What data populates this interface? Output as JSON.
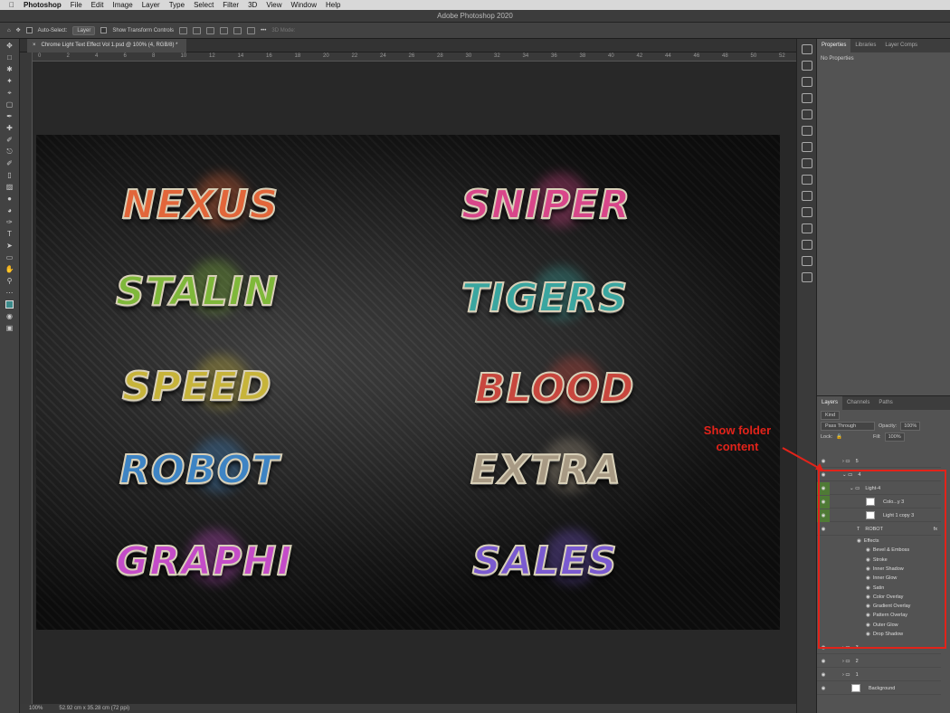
{
  "menubar": {
    "apple": "",
    "app": "Photoshop",
    "items": [
      "File",
      "Edit",
      "Image",
      "Layer",
      "Type",
      "Select",
      "Filter",
      "3D",
      "View",
      "Window",
      "Help"
    ]
  },
  "window_title": "Adobe Photoshop 2020",
  "options": {
    "auto_select": "Auto-Select:",
    "layer_value": "Layer",
    "show_transform": "Show Transform Controls",
    "mode_3d": "3D Mode:"
  },
  "doc_tab": "Chrome Light Text Effect Vol 1.psd @ 100% (4, RGB/8) *",
  "ruler_ticks": [
    "0",
    "2",
    "4",
    "6",
    "8",
    "10",
    "12",
    "14",
    "16",
    "18",
    "20",
    "22",
    "24",
    "26",
    "28",
    "30",
    "32",
    "34",
    "36",
    "38",
    "40",
    "42",
    "44",
    "46",
    "48",
    "50",
    "52"
  ],
  "artwork": {
    "words": [
      {
        "text": "NEXUS",
        "color": "#e2663a"
      },
      {
        "text": "SNIPER",
        "color": "#d8468a"
      },
      {
        "text": "STALIN",
        "color": "#7fb83a"
      },
      {
        "text": "TIGERS",
        "color": "#3aa6a0"
      },
      {
        "text": "SPEED",
        "color": "#c7b43a"
      },
      {
        "text": "BLOOD",
        "color": "#c8473e"
      },
      {
        "text": "ROBOT",
        "color": "#3e84c4"
      },
      {
        "text": "EXTRA",
        "color": "#a89a84"
      },
      {
        "text": "GRAPHI",
        "color": "#c44cc8"
      },
      {
        "text": "SALES",
        "color": "#7a5ad0"
      }
    ]
  },
  "status": {
    "zoom": "100%",
    "size": "52.92 cm x 35.28 cm (72 ppi)"
  },
  "properties": {
    "tabs": [
      "Properties",
      "Libraries",
      "Layer Comps"
    ],
    "body": "No Properties"
  },
  "layers_panel": {
    "tabs": [
      "Layers",
      "Channels",
      "Paths"
    ],
    "filter": "Kind",
    "blend": "Pass Through",
    "opacity_label": "Opacity:",
    "opacity": "100%",
    "lock_label": "Lock:",
    "fill_label": "Fill:",
    "fill": "100%",
    "rows": [
      {
        "name": "5",
        "type": "folder"
      },
      {
        "name": "4",
        "type": "folder-open"
      },
      {
        "name": "Light-4",
        "type": "folder-open"
      },
      {
        "name": "Colo...y 3",
        "type": "adjust"
      },
      {
        "name": "Light 1 copy 3",
        "type": "pixel"
      },
      {
        "name": "ROBOT",
        "type": "text"
      }
    ],
    "effects_label": "Effects",
    "effects": [
      "Bevel & Emboss",
      "Stroke",
      "Inner Shadow",
      "Inner Glow",
      "Satin",
      "Color Overlay",
      "Gradient Overlay",
      "Pattern Overlay",
      "Outer Glow",
      "Drop Shadow"
    ],
    "bottom_rows": [
      "3",
      "2",
      "1",
      "Background"
    ],
    "fx_label": "fx"
  },
  "annotation": {
    "line1": "Show folder",
    "line2": "content",
    "color": "#e2231a"
  }
}
